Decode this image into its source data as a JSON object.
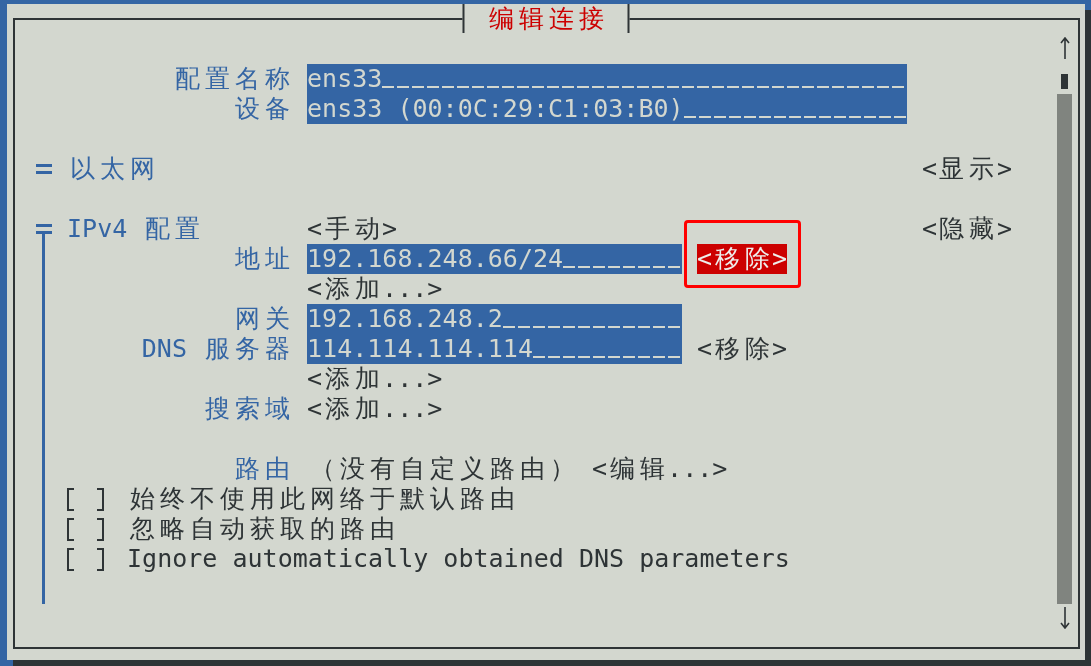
{
  "window": {
    "title": "编辑连接"
  },
  "profile": [
    {
      "label": "配置名称",
      "value": "ens33"
    },
    {
      "label": "设备",
      "value": "ens33 (00:0C:29:C1:03:B0)"
    }
  ],
  "sections": [
    {
      "title": "以太网",
      "expanded": false,
      "toggle": "<显示>"
    },
    {
      "title": "IPv4 配置",
      "expanded": true,
      "mode": "<手动>",
      "toggle": "<隐藏>",
      "rows": [
        {
          "kind": "entry",
          "label": "地址",
          "value": "192.168.248.66/24",
          "remove": {
            "label": "<移除>",
            "focused": true,
            "annotated": true
          }
        },
        {
          "kind": "add",
          "button": "<添加...>"
        },
        {
          "kind": "entry",
          "label": "网关",
          "value": "192.168.248.2"
        },
        {
          "kind": "entry",
          "label": "DNS 服务器",
          "value": "114.114.114.114",
          "remove": {
            "label": "<移除>",
            "focused": false,
            "annotated": false
          }
        },
        {
          "kind": "add",
          "button": "<添加...>"
        },
        {
          "kind": "add",
          "label": "搜索域",
          "button": "<添加...>"
        },
        {
          "kind": "route",
          "label": "路由",
          "summary": "（没有自定义路由）",
          "button": "<编辑...>"
        },
        {
          "kind": "checkbox",
          "label": "始终不使用此网络于默认路由",
          "checked": false
        },
        {
          "kind": "checkbox",
          "label": "忽略自动获取的路由",
          "checked": false
        },
        {
          "kind": "checkbox",
          "label": "Ignore automatically obtained DNS parameters",
          "checked": false
        }
      ]
    }
  ]
}
